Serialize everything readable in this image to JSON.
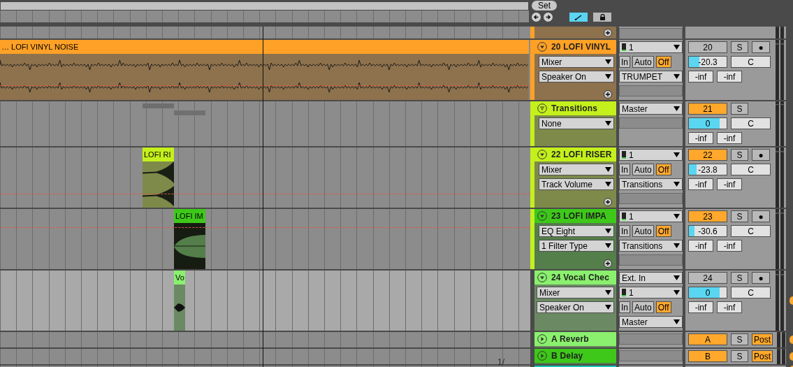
{
  "toolbar": {
    "set_button": "Set",
    "follow": {
      "selected": true
    },
    "lock": {
      "selected": false
    }
  },
  "tracks": [
    {
      "kind": "tail",
      "group_strip": {
        "color": "#ffa126"
      },
      "selected": false,
      "add_button": true,
      "io": [
        {
          "kind": "empty"
        }
      ]
    },
    {
      "kind": "audio",
      "name": "20 LOFI VINYL",
      "color": "#ffa126",
      "group_strip": {
        "color": "#ffa126"
      },
      "expanded": true,
      "selected": false,
      "automation": true,
      "devices": [
        "Mixer",
        "Speaker On"
      ],
      "add_button": true,
      "io": [
        {
          "kind": "input",
          "value": "1"
        },
        {
          "kind": "monitor",
          "options": [
            {
              "label": "In",
              "selected": false
            },
            {
              "label": "Auto",
              "selected": false
            },
            {
              "label": "Off",
              "selected": true
            }
          ]
        },
        {
          "kind": "dropdown",
          "value": "TRUMPET"
        },
        {
          "kind": "empty"
        }
      ],
      "mixer": {
        "number": "20",
        "active": false,
        "solo": "S",
        "third": {
          "kind": "arm",
          "label": "●",
          "on": false
        },
        "volume": "-20.3",
        "level": 0.27,
        "pan": "C",
        "peaks": [
          "-inf",
          "-inf"
        ]
      },
      "clips": [
        {
          "kind": "noise",
          "name": "… LOFI VINYL NOISE",
          "color": "#ffa126"
        }
      ]
    },
    {
      "kind": "group",
      "name": "Transitions",
      "color": "#c4f01c",
      "group_strip": {
        "color": "#c4f01c"
      },
      "selected": false,
      "automation": false,
      "devices": [
        "None"
      ],
      "add_button": false,
      "io": [
        {
          "kind": "dropdown",
          "value": "Master"
        },
        {
          "kind": "empty"
        }
      ],
      "mixer": {
        "number": "21",
        "active": true,
        "solo": "S",
        "volume": "0",
        "level": 0.82,
        "pan": "C",
        "peaks": [
          "-inf",
          "-inf"
        ]
      }
    },
    {
      "kind": "audio",
      "name": "22 LOFI RISER",
      "color": "#c4f01c",
      "group_strip": {
        "color": "#c4f01c"
      },
      "expanded": true,
      "selected": false,
      "automation": true,
      "devices": [
        "Mixer",
        "Track Volume"
      ],
      "add_button": true,
      "io": [
        {
          "kind": "input",
          "value": "1"
        },
        {
          "kind": "monitor",
          "options": [
            {
              "label": "In",
              "selected": false
            },
            {
              "label": "Auto",
              "selected": false
            },
            {
              "label": "Off",
              "selected": true
            }
          ]
        },
        {
          "kind": "dropdown",
          "value": "Transitions"
        },
        {
          "kind": "empty"
        }
      ],
      "mixer": {
        "number": "22",
        "active": true,
        "solo": "S",
        "third": {
          "kind": "arm",
          "label": "●",
          "on": false
        },
        "volume": "-23.8",
        "level": 0.2,
        "pan": "C",
        "peaks": [
          "-inf",
          "-inf"
        ]
      },
      "clips": [
        {
          "kind": "riser",
          "name": "LOFI RI",
          "color": "#c4f01c"
        }
      ]
    },
    {
      "kind": "audio",
      "name": "23 LOFI IMPA",
      "color": "#3ec81a",
      "group_strip": {
        "color": "#c4f01c"
      },
      "expanded": true,
      "selected": false,
      "automation": true,
      "devices": [
        "EQ Eight",
        "1 Filter Type"
      ],
      "add_button": true,
      "io": [
        {
          "kind": "input",
          "value": "1"
        },
        {
          "kind": "monitor",
          "options": [
            {
              "label": "In",
              "selected": false
            },
            {
              "label": "Auto",
              "selected": false
            },
            {
              "label": "Off",
              "selected": true
            }
          ]
        },
        {
          "kind": "dropdown",
          "value": "Transitions"
        },
        {
          "kind": "empty"
        }
      ],
      "mixer": {
        "number": "23",
        "active": true,
        "solo": "S",
        "third": {
          "kind": "arm",
          "label": "●",
          "on": false
        },
        "volume": "-30.6",
        "level": 0.14,
        "pan": "C",
        "peaks": [
          "-inf",
          "-inf"
        ]
      },
      "clips": [
        {
          "kind": "impact",
          "name": "LOFI IM",
          "color": "#3ec81a"
        }
      ]
    },
    {
      "kind": "audio",
      "name": "24 Vocal Chec",
      "color": "#8af06e",
      "expanded": true,
      "selected": true,
      "automation": false,
      "devices": [
        "Mixer",
        "Speaker On"
      ],
      "add_button": false,
      "io": [
        {
          "kind": "dropdown",
          "value": "Ext. In"
        },
        {
          "kind": "input",
          "value": "1"
        },
        {
          "kind": "monitor",
          "options": [
            {
              "label": "In",
              "selected": false
            },
            {
              "label": "Auto",
              "selected": false
            },
            {
              "label": "Off",
              "selected": true
            }
          ]
        },
        {
          "kind": "dropdown",
          "value": "Master"
        }
      ],
      "mixer": {
        "number": "24",
        "active": false,
        "solo": "S",
        "third": {
          "kind": "arm",
          "label": "●",
          "on": false
        },
        "volume": "0",
        "level": 0.82,
        "pan": "C",
        "peaks": [
          "-inf",
          "-inf"
        ]
      },
      "clips": [
        {
          "kind": "vocal",
          "name": "Vo",
          "color": "#8af06e"
        }
      ]
    },
    {
      "kind": "return",
      "name": "A Reverb",
      "color": "#8af06e",
      "expanded": false,
      "selected": false,
      "io": [
        {
          "kind": "empty"
        }
      ],
      "mixer": {
        "number": "A",
        "active": true,
        "solo": "S",
        "third": {
          "kind": "post",
          "label": "Post",
          "on": true
        }
      }
    },
    {
      "kind": "return",
      "name": "B Delay",
      "color": "#3ec81a",
      "expanded": false,
      "selected": false,
      "io": [
        {
          "kind": "empty"
        }
      ],
      "mixer": {
        "number": "B",
        "active": true,
        "solo": "S",
        "third": {
          "kind": "post",
          "label": "Post",
          "on": true
        }
      }
    },
    {
      "kind": "partial",
      "color": "#19c4b4",
      "selected": false
    }
  ],
  "page_indicator": "1/"
}
